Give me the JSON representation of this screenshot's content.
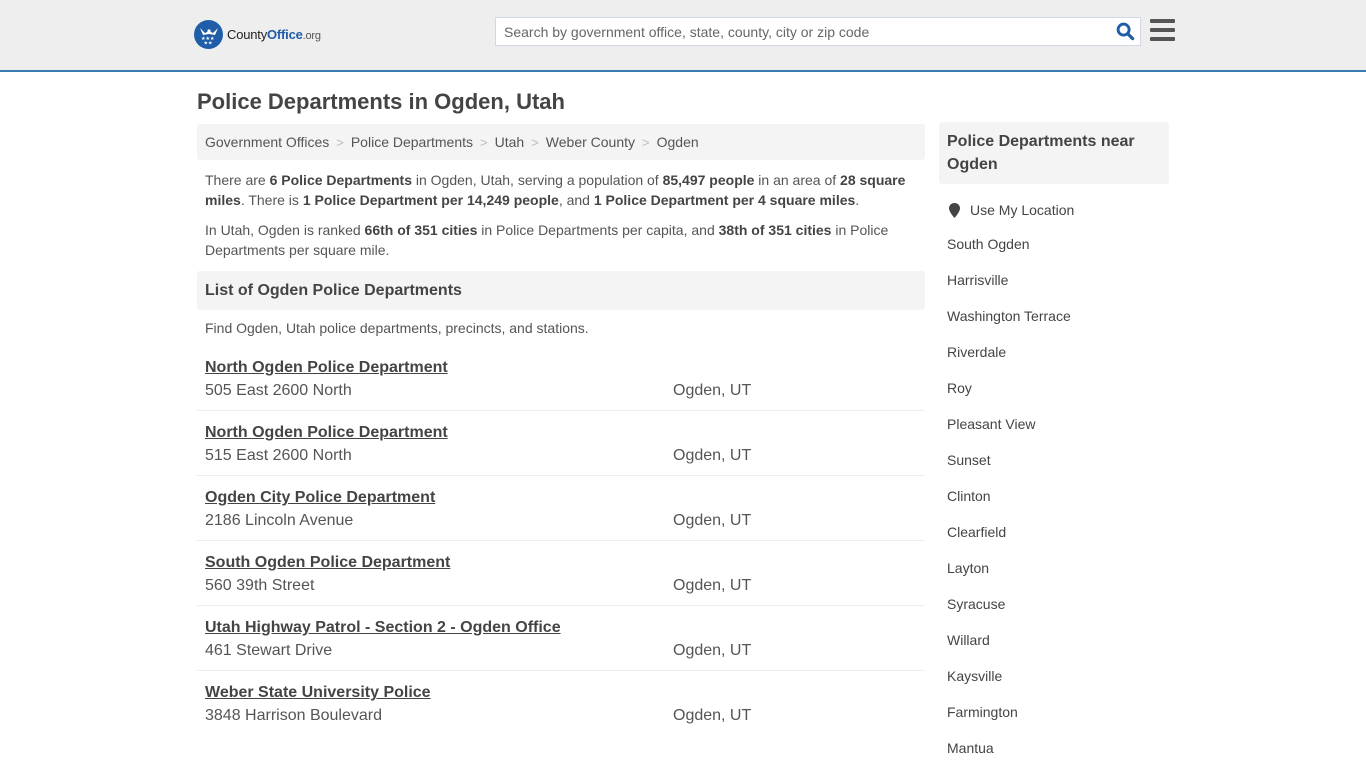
{
  "header": {
    "logo": {
      "name_part1": "County",
      "name_part2": "Office",
      "tld": ".org"
    },
    "search": {
      "placeholder": "Search by government office, state, county, city or zip code",
      "value": ""
    },
    "icons": {
      "search": "search-icon",
      "menu": "hamburger-menu-icon"
    }
  },
  "page": {
    "title": "Police Departments in Ogden, Utah"
  },
  "breadcrumb": [
    {
      "label": "Government Offices"
    },
    {
      "label": "Police Departments"
    },
    {
      "label": "Utah"
    },
    {
      "label": "Weber County"
    },
    {
      "label": "Ogden"
    }
  ],
  "breadcrumb_separator": ">",
  "intro": {
    "p1": {
      "t1": "There are ",
      "b1": "6 Police Departments",
      "t2": " in Ogden, Utah, serving a population of ",
      "b2": "85,497 people",
      "t3": " in an area of ",
      "b3": "28 square miles",
      "t4": ". There is ",
      "b4": "1 Police Department per 14,249 people",
      "t5": ", and ",
      "b5": "1 Police Department per 4 square miles",
      "t6": "."
    },
    "p2": {
      "t1": "In Utah, Ogden is ranked ",
      "b1": "66th of 351 cities",
      "t2": " in Police Departments per capita, and ",
      "b2": "38th of 351 cities",
      "t3": " in Police Departments per square mile."
    }
  },
  "list": {
    "heading": "List of Ogden Police Departments",
    "description": "Find Ogden, Utah police departments, precincts, and stations.",
    "items": [
      {
        "name": "North Ogden Police Department",
        "address": "505 East 2600 North",
        "city": "Ogden, UT"
      },
      {
        "name": "North Ogden Police Department",
        "address": "515 East 2600 North",
        "city": "Ogden, UT"
      },
      {
        "name": "Ogden City Police Department",
        "address": "2186 Lincoln Avenue",
        "city": "Ogden, UT"
      },
      {
        "name": "South Ogden Police Department",
        "address": "560 39th Street",
        "city": "Ogden, UT"
      },
      {
        "name": "Utah Highway Patrol - Section 2 - Ogden Office",
        "address": "461 Stewart Drive",
        "city": "Ogden, UT"
      },
      {
        "name": "Weber State University Police",
        "address": "3848 Harrison Boulevard",
        "city": "Ogden, UT"
      }
    ]
  },
  "sidebar": {
    "heading": "Police Departments near Ogden",
    "use_location": "Use My Location",
    "nearby": [
      "South Ogden",
      "Harrisville",
      "Washington Terrace",
      "Riverdale",
      "Roy",
      "Pleasant View",
      "Sunset",
      "Clinton",
      "Clearfield",
      "Layton",
      "Syracuse",
      "Willard",
      "Kaysville",
      "Farmington",
      "Mantua"
    ]
  },
  "colors": {
    "brand_blue": "#1f5da8",
    "header_bg": "#eeeeee",
    "header_border": "#3a7bb5",
    "panel_bg": "#f4f4f4",
    "text": "#444444"
  }
}
